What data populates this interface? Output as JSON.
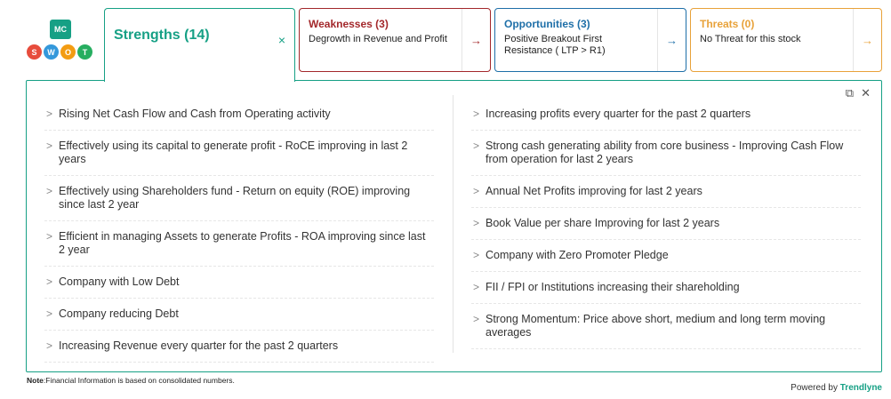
{
  "logo": {
    "top_text": "MC",
    "letters": [
      "S",
      "W",
      "O",
      "T"
    ],
    "colors": [
      "#e74c3c",
      "#3498db",
      "#f39c12",
      "#27ae60"
    ]
  },
  "tabs": {
    "strengths": {
      "label": "Strengths (14)",
      "close_icon": "×",
      "color": "#16a085"
    },
    "weaknesses": {
      "label": "Weaknesses (3)",
      "desc": "Degrowth in Revenue and Profit",
      "arrow": "→",
      "color": "#a3282b"
    },
    "opportunities": {
      "label": "Opportunities (3)",
      "desc": "Positive Breakout First Resistance ( LTP > R1)",
      "arrow": "→",
      "color": "#1e6fa8"
    },
    "threats": {
      "label": "Threats (0)",
      "desc": "No Threat for this stock",
      "arrow": "→",
      "color": "#e8a23a"
    }
  },
  "panel": {
    "tools": {
      "popout": "⧉",
      "close": "✕"
    },
    "left_items": [
      "Rising Net Cash Flow and Cash from Operating activity",
      "Effectively using its capital to generate profit - RoCE improving in last 2 years",
      "Effectively using Shareholders fund - Return on equity (ROE) improving since last 2 year",
      "Efficient in managing Assets to generate Profits - ROA improving since last 2 year",
      "Company with Low Debt",
      "Company reducing Debt",
      "Increasing Revenue every quarter for the past 2 quarters"
    ],
    "right_items": [
      "Increasing profits every quarter for the past 2 quarters",
      "Strong cash generating ability from core business - Improving Cash Flow from operation for last 2 years",
      "Annual Net Profits improving for last 2 years",
      "Book Value per share Improving for last 2 years",
      "Company with Zero Promoter Pledge",
      "FII / FPI or Institutions increasing their shareholding",
      "Strong Momentum: Price above short, medium and long term moving averages"
    ],
    "chevron": ">"
  },
  "footer": {
    "note_label": "Note",
    "note_text": ":Financial Information is based on consolidated numbers.",
    "powered_by": "Powered by",
    "brand": "Trendlyne"
  }
}
